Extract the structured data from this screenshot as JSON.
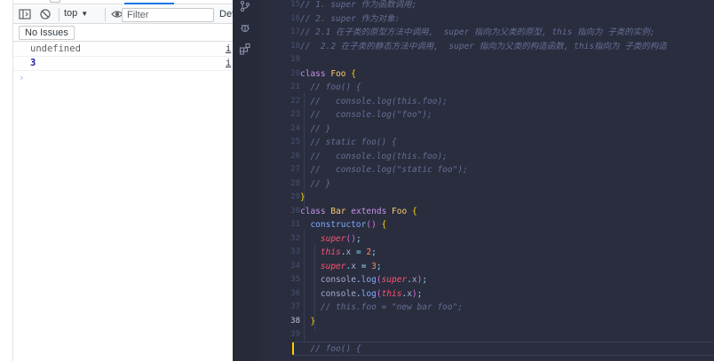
{
  "devtools": {
    "toolbar": {
      "context_label": "top",
      "filter_placeholder": "Filter",
      "levels_label": "Def"
    },
    "issues_label": "No Issues",
    "log": [
      {
        "value": "undefined",
        "source": "i"
      },
      {
        "value": "3",
        "source": "i"
      }
    ],
    "prompt_symbol": "›"
  },
  "editor": {
    "theme": {
      "background": "#292d3e",
      "comment": "#676e95",
      "keyword": "#c792ea",
      "class": "#ffcb6b",
      "function": "#82aaff",
      "super": "#ff5370",
      "number": "#f78c6c",
      "string": "#c3e88d",
      "cursor": "#ffcc00"
    },
    "activity_icons": [
      "source-control-icon",
      "debug-icon",
      "extensions-icon"
    ],
    "line_numbers": [
      "15",
      "16",
      "17",
      "18",
      "19",
      "20",
      "21",
      "22",
      "23",
      "24",
      "25",
      "26",
      "27",
      "28",
      "29",
      "30",
      "31",
      "32",
      "33",
      "34",
      "35",
      "36",
      "37",
      "38",
      "39"
    ],
    "active_line": "38",
    "lines": [
      "// 1. super 作为函数调用;",
      "// 2. super 作为对象:",
      "// 2.1 在子类的原型方法中调用,  super 指向为父类的原型, this 指向为 子类的实例;",
      "//  2.2 在子类的静态方法中调用,  super 指向为父类的构造函数, this指向为 子类的构造",
      "",
      "class Foo {",
      "  // foo() {",
      "  //   console.log(this.foo);",
      "  //   console.log(\"foo\");",
      "  // }",
      "  // static foo() {",
      "  //   console.log(this.foo);",
      "  //   console.log(\"static foo\");",
      "  // }",
      "}",
      "class Bar extends Foo {",
      "  constructor() {",
      "    super();",
      "    this.x = 2;",
      "    super.x = 3;",
      "    console.log(super.x);",
      "    console.log(this.x);",
      "    // this.foo = \"new bar foo\";",
      "  }",
      "",
      "  // foo() {"
    ]
  }
}
